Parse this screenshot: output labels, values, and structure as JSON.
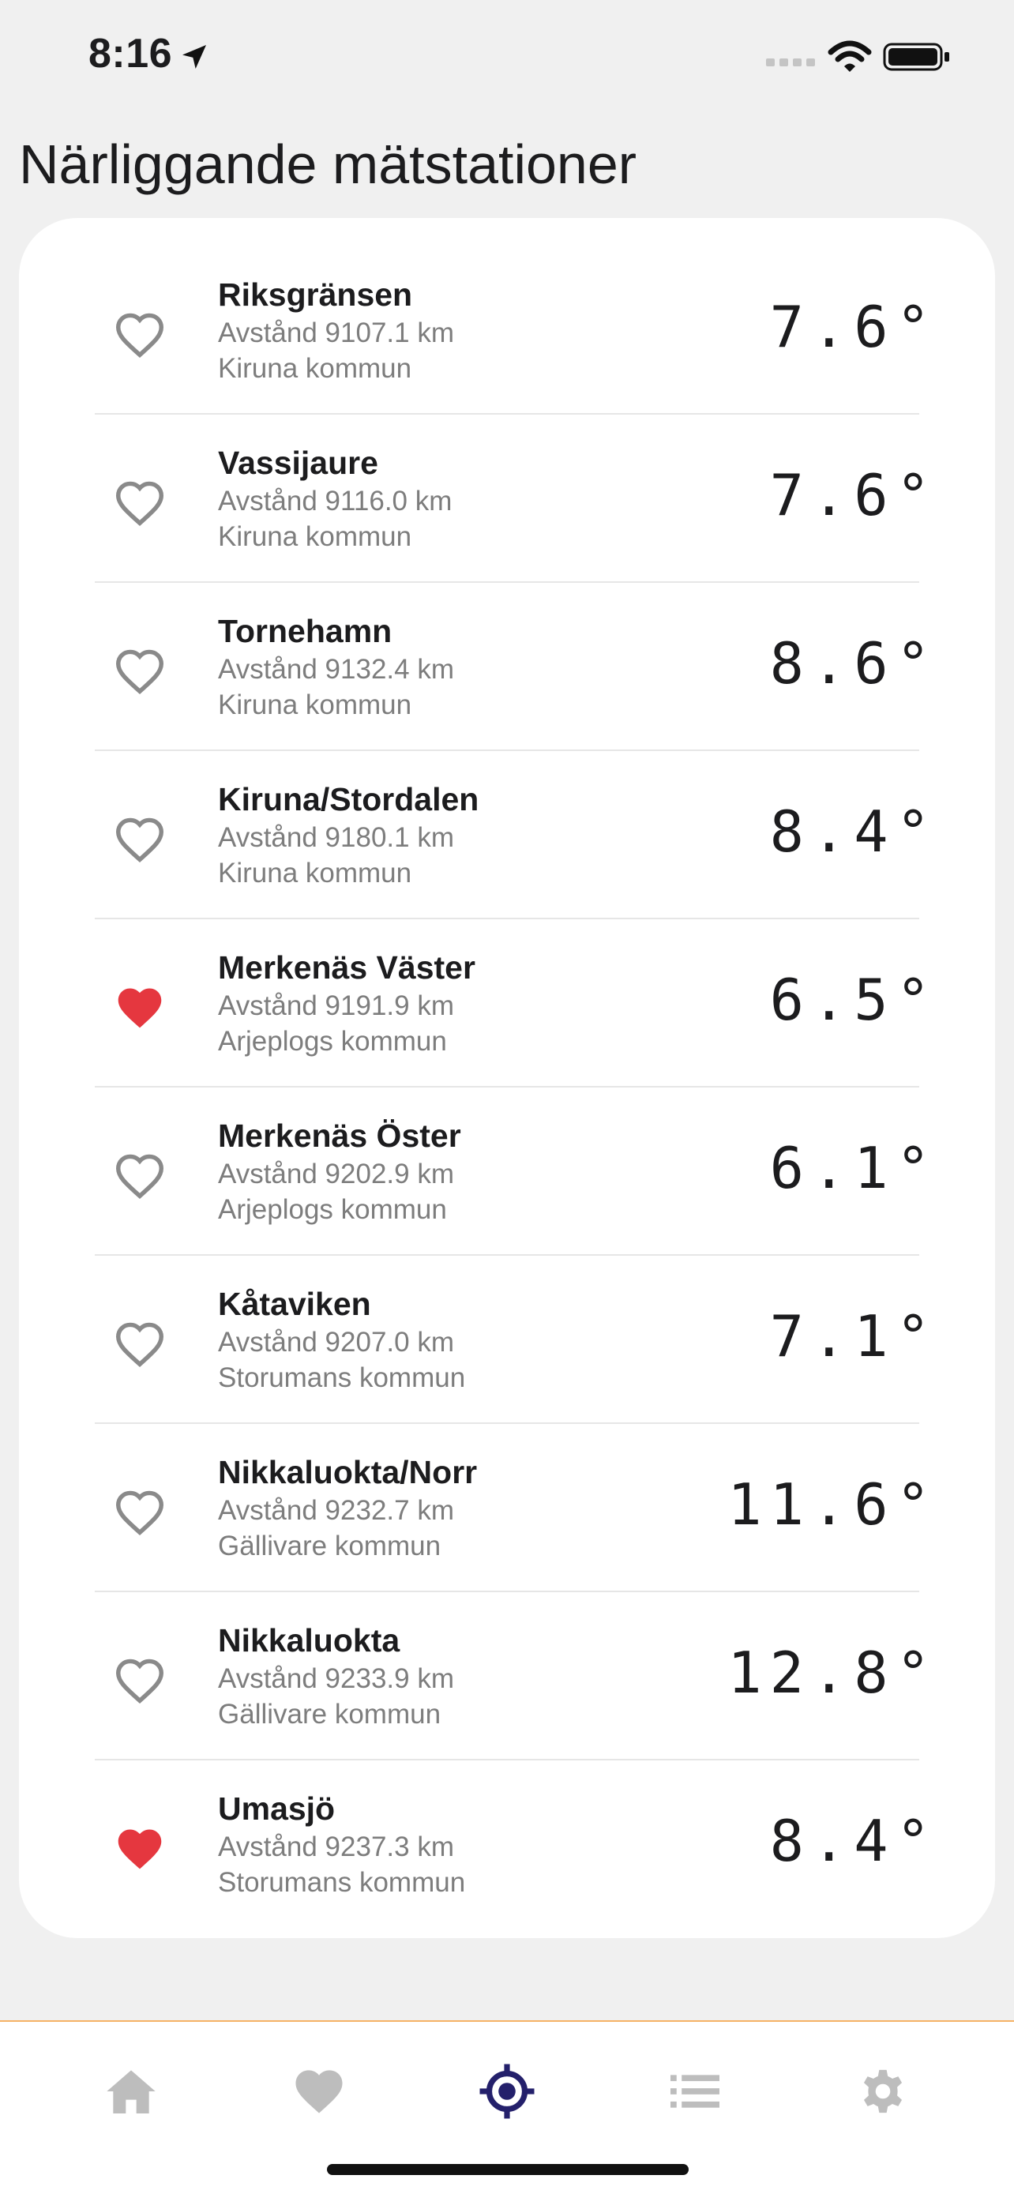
{
  "status_bar": {
    "time": "8:16"
  },
  "page": {
    "title": "Närliggande mätstationer"
  },
  "colors": {
    "heart_active": "#e5373f",
    "heart_inactive": "#8a8a8a",
    "tab_active": "#24206b",
    "tab_inactive": "#bdbdbd",
    "tabbar_border": "#f5b266"
  },
  "stations": [
    {
      "name": "Riksgränsen",
      "distance": "Avstånd 9107.1 km",
      "municipality": "Kiruna kommun",
      "temp": "7.6°",
      "favorite": false
    },
    {
      "name": "Vassijaure",
      "distance": "Avstånd 9116.0 km",
      "municipality": "Kiruna kommun",
      "temp": "7.6°",
      "favorite": false
    },
    {
      "name": "Tornehamn",
      "distance": "Avstånd 9132.4 km",
      "municipality": "Kiruna kommun",
      "temp": "8.6°",
      "favorite": false
    },
    {
      "name": "Kiruna/Stordalen",
      "distance": "Avstånd 9180.1 km",
      "municipality": "Kiruna kommun",
      "temp": "8.4°",
      "favorite": false
    },
    {
      "name": "Merkenäs Väster",
      "distance": "Avstånd 9191.9 km",
      "municipality": "Arjeplogs kommun",
      "temp": "6.5°",
      "favorite": true
    },
    {
      "name": "Merkenäs Öster",
      "distance": "Avstånd 9202.9 km",
      "municipality": "Arjeplogs kommun",
      "temp": "6.1°",
      "favorite": false
    },
    {
      "name": "Kåtaviken",
      "distance": "Avstånd 9207.0 km",
      "municipality": "Storumans kommun",
      "temp": "7.1°",
      "favorite": false
    },
    {
      "name": "Nikkaluokta/Norr",
      "distance": "Avstånd 9232.7 km",
      "municipality": "Gällivare kommun",
      "temp": "11.6°",
      "favorite": false
    },
    {
      "name": "Nikkaluokta",
      "distance": "Avstånd 9233.9 km",
      "municipality": "Gällivare kommun",
      "temp": "12.8°",
      "favorite": false
    },
    {
      "name": "Umasjö",
      "distance": "Avstånd 9237.3 km",
      "municipality": "Storumans kommun",
      "temp": "8.4°",
      "favorite": true
    }
  ],
  "tabs": [
    {
      "icon": "home-icon",
      "active": false
    },
    {
      "icon": "heart-icon",
      "active": false
    },
    {
      "icon": "location-target-icon",
      "active": true
    },
    {
      "icon": "list-icon",
      "active": false
    },
    {
      "icon": "gear-icon",
      "active": false
    }
  ]
}
